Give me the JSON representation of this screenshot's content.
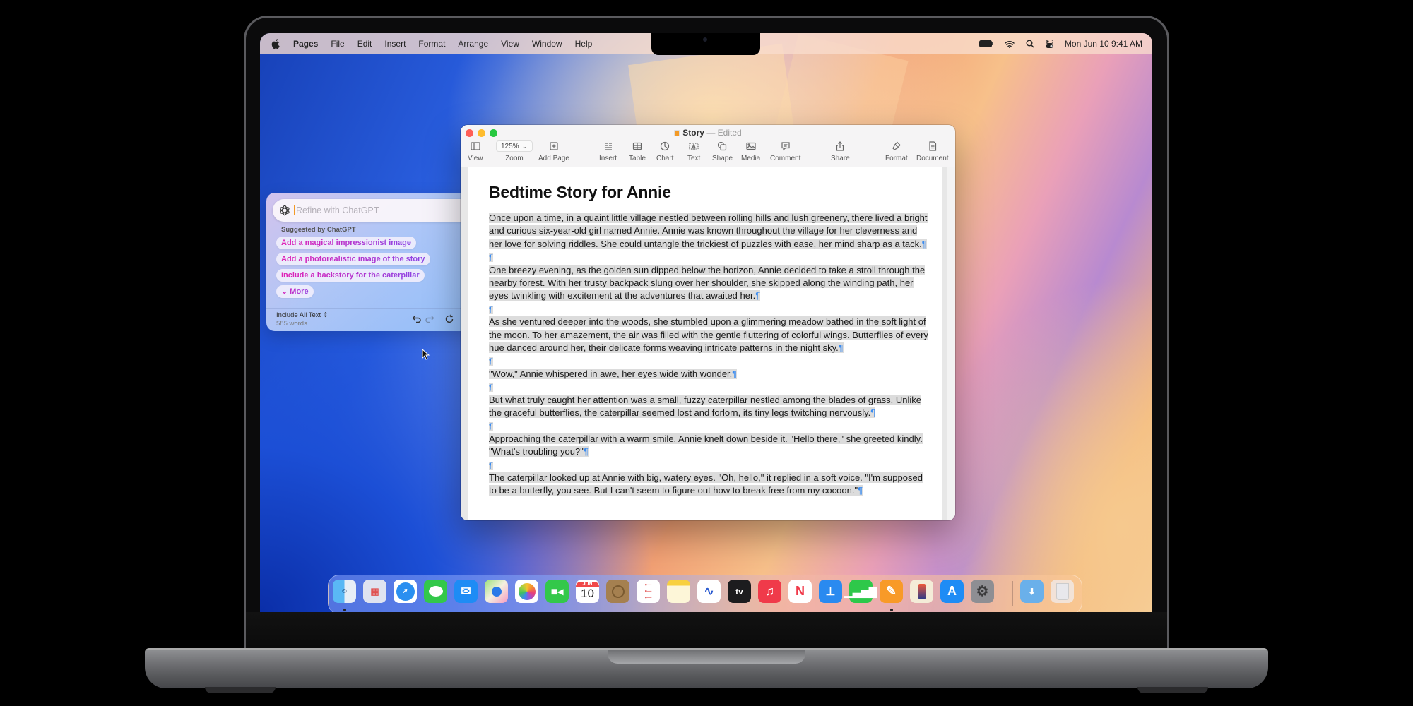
{
  "menubar": {
    "app": "Pages",
    "items": [
      "File",
      "Edit",
      "Insert",
      "Format",
      "Arrange",
      "View",
      "Window",
      "Help"
    ],
    "status_icons": [
      "battery-icon",
      "wifi-icon",
      "spotlight-search-icon",
      "control-center-icon"
    ],
    "datetime": "Mon Jun 10  9:41 AM"
  },
  "window": {
    "title": "Story",
    "title_separator": "—",
    "status": "Edited",
    "toolbar": {
      "view": "View",
      "zoom_value": "125%",
      "zoom": "Zoom",
      "add_page": "Add Page",
      "insert": "Insert",
      "table": "Table",
      "chart": "Chart",
      "text": "Text",
      "shape": "Shape",
      "media": "Media",
      "comment": "Comment",
      "share": "Share",
      "format": "Format",
      "document": "Document"
    },
    "document": {
      "title": "Bedtime Story for Annie",
      "paragraphs": [
        "Once upon a time, in a quaint little village nestled between rolling hills and lush greenery, there lived a bright and curious six-year-old girl named Annie. Annie was known throughout the village for her cleverness and her love for solving riddles. She could untangle the trickiest of puzzles with ease, her mind sharp as a tack.",
        "One breezy evening, as the golden sun dipped below the horizon, Annie decided to take a stroll through the nearby forest. With her trusty backpack slung over her shoulder, she skipped along the winding path, her eyes twinkling with excitement at the adventures that awaited her.",
        "As she ventured deeper into the woods, she stumbled upon a glimmering meadow bathed in the soft light of the moon. To her amazement, the air was filled with the gentle fluttering of colorful wings. Butterflies of every hue danced around her, their delicate forms weaving intricate patterns in the night sky.",
        "\"Wow,\" Annie whispered in awe, her eyes wide with wonder.",
        "But what truly caught her attention was a small, fuzzy caterpillar nestled among the blades of grass. Unlike the graceful butterflies, the caterpillar seemed lost and forlorn, its tiny legs twitching nervously.",
        "Approaching the caterpillar with a warm smile, Annie knelt down beside it. \"Hello there,\" she greeted kindly. \"What's troubling you?\"",
        "The caterpillar looked up at Annie with big, watery eyes. \"Oh, hello,\" it replied in a soft voice. \"I'm supposed to be a butterfly, you see. But I can't seem to figure out how to break free from my cocoon.\""
      ],
      "pilcrow": "¶"
    }
  },
  "chatgpt_panel": {
    "input_placeholder": "Refine with ChatGPT",
    "input_value": "",
    "suggested_label": "Suggested by ChatGPT",
    "suggestions": [
      "Add a magical impressionist image",
      "Add a photorealistic image of the story",
      "Include a backstory for the caterpillar"
    ],
    "more_label": "More",
    "scope_label": "Include All Text",
    "word_count": "585 words"
  },
  "dock": {
    "apps": [
      {
        "name": "Finder",
        "icon": "finder-icon",
        "running": true
      },
      {
        "name": "Launchpad",
        "icon": "launchpad-icon",
        "running": false
      },
      {
        "name": "Safari",
        "icon": "safari-icon",
        "running": false
      },
      {
        "name": "Messages",
        "icon": "messages-icon",
        "running": false
      },
      {
        "name": "Mail",
        "icon": "mail-icon",
        "running": false
      },
      {
        "name": "Maps",
        "icon": "maps-icon",
        "running": false
      },
      {
        "name": "Photos",
        "icon": "photos-icon",
        "running": false
      },
      {
        "name": "FaceTime",
        "icon": "facetime-icon",
        "running": false
      },
      {
        "name": "Calendar",
        "icon": "calendar-icon",
        "running": false,
        "month": "JUN",
        "day": "10"
      },
      {
        "name": "Contacts",
        "icon": "contacts-icon",
        "running": false
      },
      {
        "name": "Reminders",
        "icon": "reminders-icon",
        "running": false
      },
      {
        "name": "Notes",
        "icon": "notes-icon",
        "running": false
      },
      {
        "name": "Freeform",
        "icon": "freeform-icon",
        "running": false
      },
      {
        "name": "TV",
        "icon": "apple-tv-icon",
        "running": false,
        "label": "tv"
      },
      {
        "name": "Music",
        "icon": "music-icon",
        "running": false
      },
      {
        "name": "News",
        "icon": "news-icon",
        "running": false
      },
      {
        "name": "Keynote",
        "icon": "keynote-icon",
        "running": false
      },
      {
        "name": "Numbers",
        "icon": "numbers-icon",
        "running": false
      },
      {
        "name": "Pages",
        "icon": "pages-icon",
        "running": true
      },
      {
        "name": "iPhone Mirroring",
        "icon": "iphone-mirroring-icon",
        "running": false
      },
      {
        "name": "App Store",
        "icon": "app-store-icon",
        "running": false
      },
      {
        "name": "System Settings",
        "icon": "system-settings-icon",
        "running": false
      }
    ],
    "extras": [
      {
        "name": "Downloads",
        "icon": "downloads-folder-icon"
      },
      {
        "name": "Trash",
        "icon": "trash-icon"
      }
    ]
  }
}
